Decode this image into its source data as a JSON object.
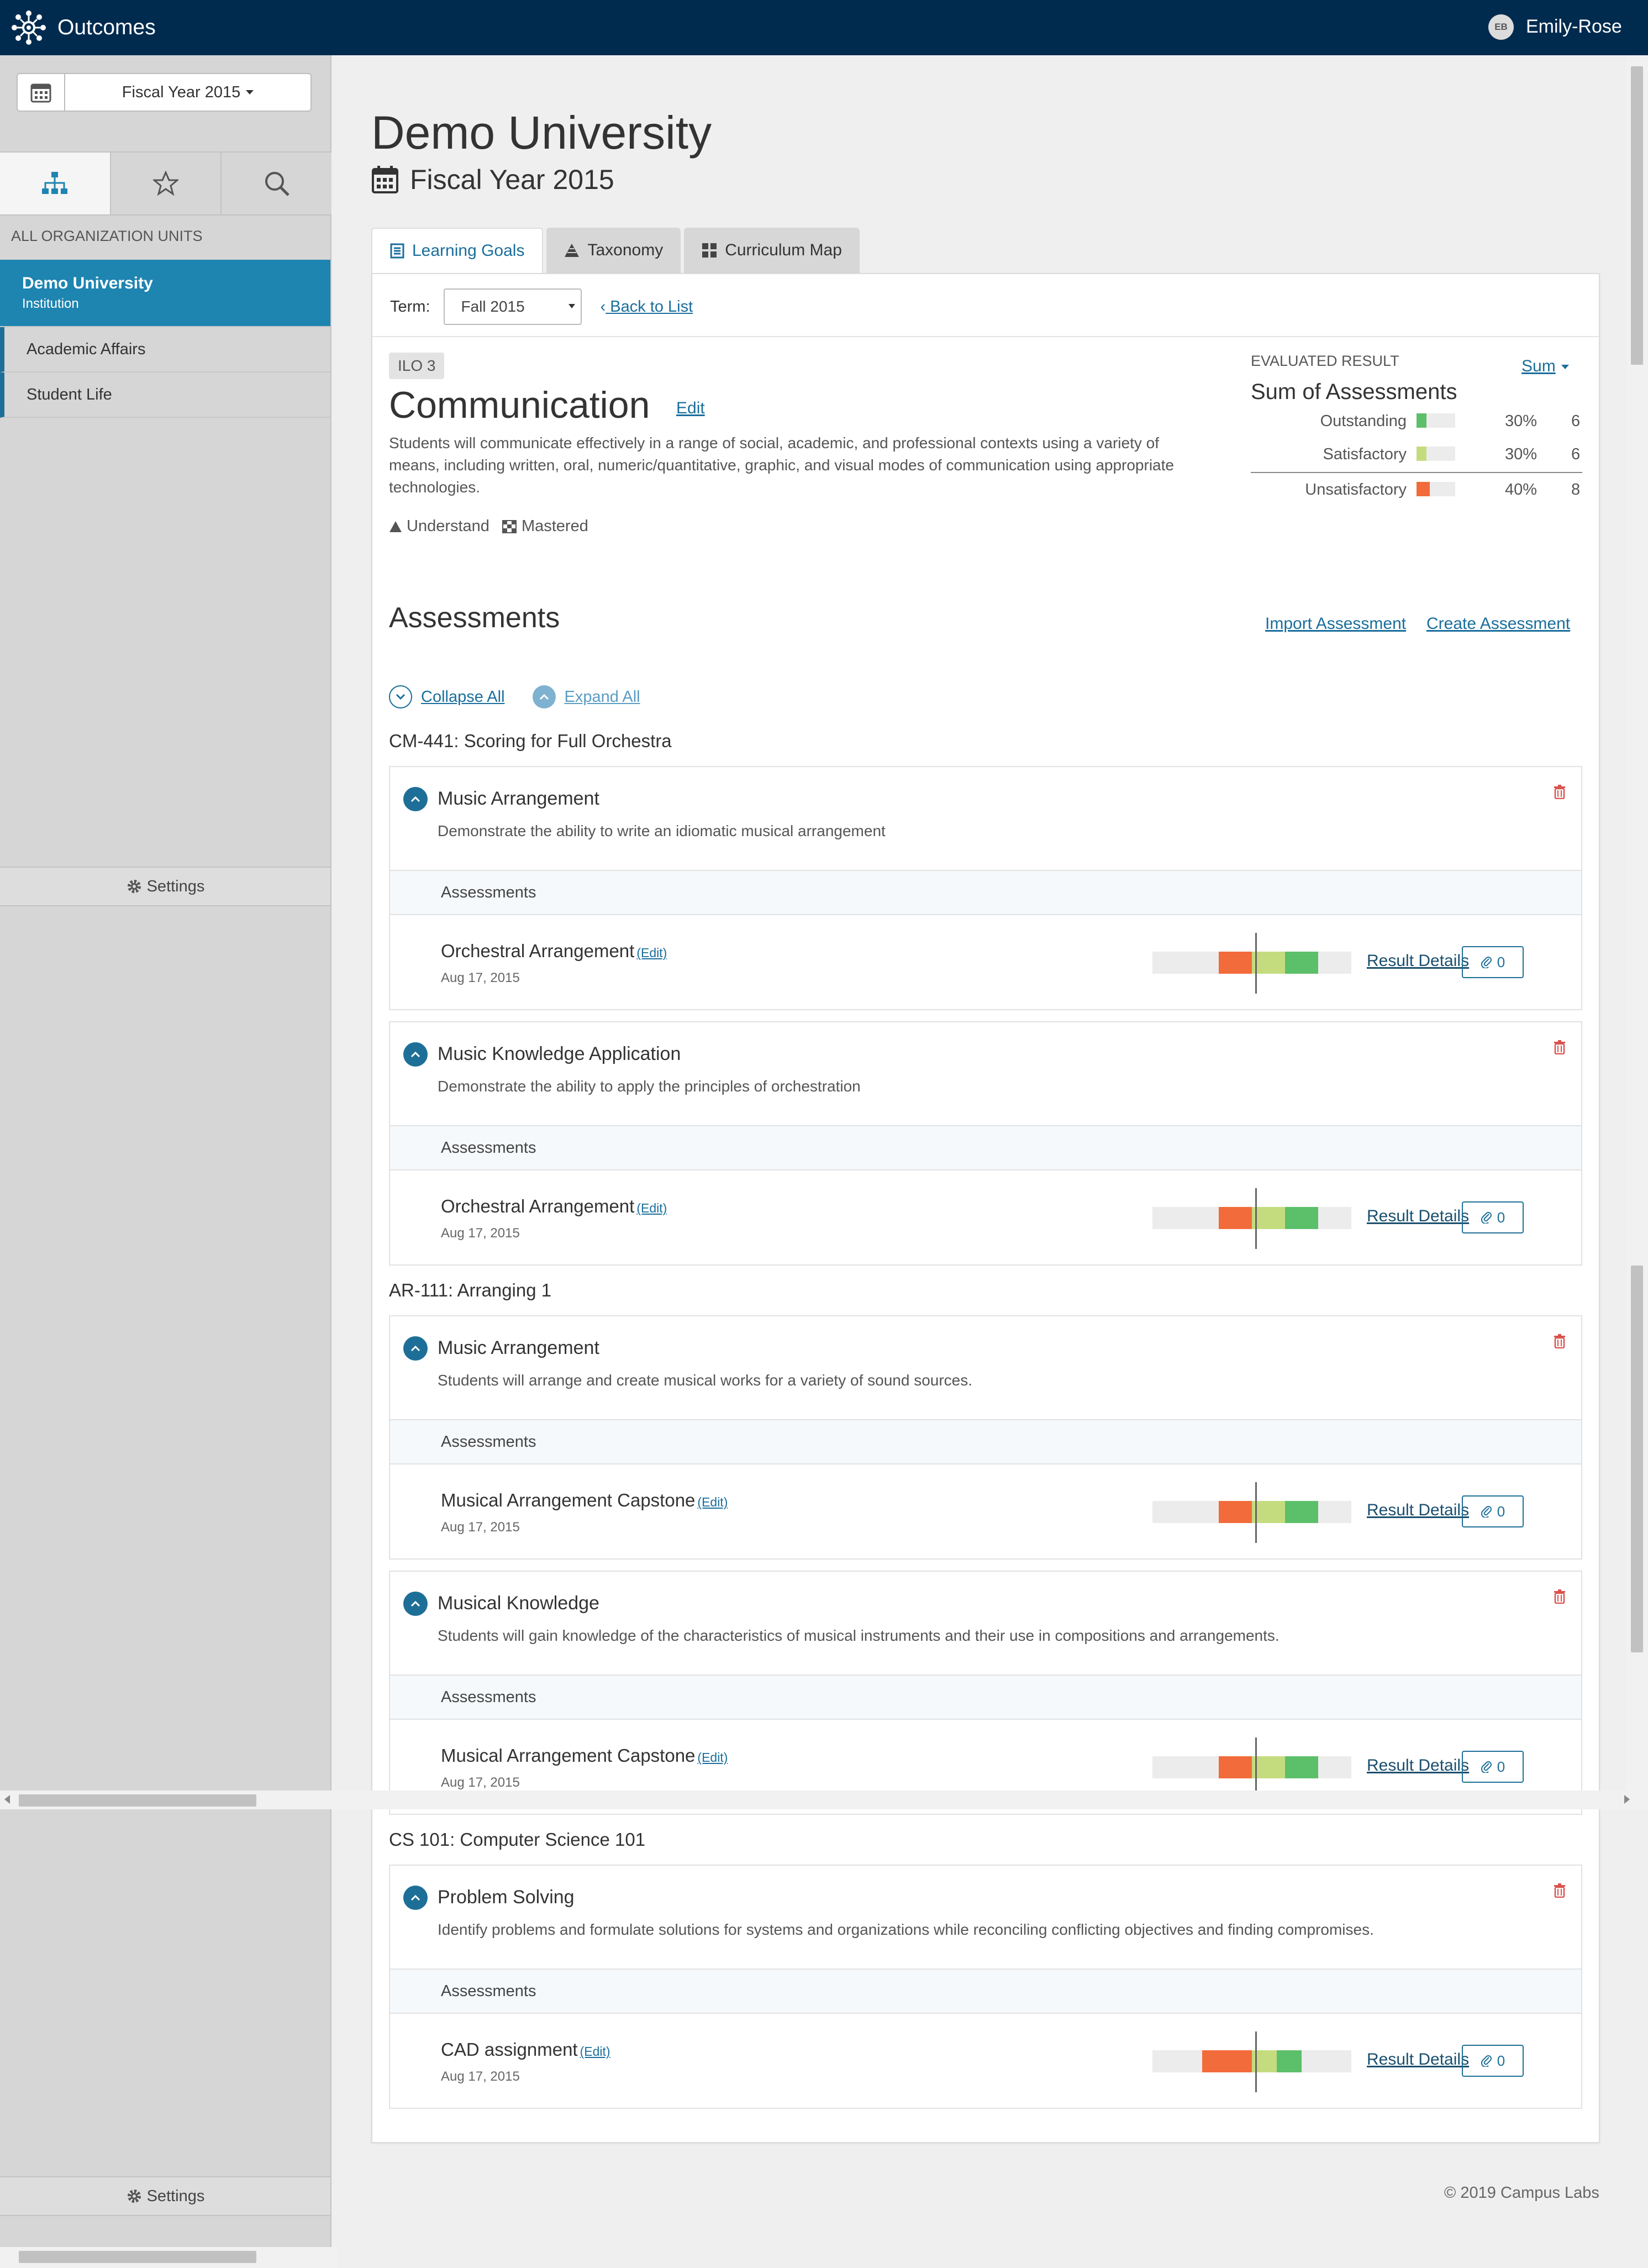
{
  "topbar": {
    "app_title": "Outcomes",
    "user_initials": "EB",
    "user_name": "Emily-Rose"
  },
  "sidebar": {
    "fiscal_year": "Fiscal Year 2015",
    "org_heading": "ALL ORGANIZATION UNITS",
    "org_units": [
      {
        "name": "Demo University",
        "sub": "Institution"
      },
      {
        "name": "Academic Affairs"
      },
      {
        "name": "Student Life"
      }
    ],
    "settings_label": "Settings"
  },
  "main": {
    "title": "Demo University",
    "fiscal_year": "Fiscal Year 2015",
    "tabs": [
      {
        "label": "Learning Goals",
        "icon": "list-icon"
      },
      {
        "label": "Taxonomy",
        "icon": "pyramid-icon"
      },
      {
        "label": "Curriculum Map",
        "icon": "grid-icon"
      }
    ],
    "term_label": "Term:",
    "term_value": "Fall 2015",
    "back_link": "Back to List"
  },
  "goal": {
    "badge": "ILO 3",
    "title": "Communication",
    "edit_label": "Edit",
    "description": "Students will communicate effectively in a range of social, academic, and professional contexts using a variety of means, including written, oral, numeric/quantitative, graphic, and visual modes of communication using appropriate technologies.",
    "tag_taxonomy": "Understand",
    "tag_mastery": "Mastered"
  },
  "evaluated": {
    "label": "EVALUATED RESULT",
    "sum_link": "Sum",
    "title": "Sum of Assessments",
    "rows": [
      {
        "label": "Outstanding",
        "pct": "30%",
        "count": "6",
        "fraction": 0.3,
        "color": "#5cbf6a"
      },
      {
        "label": "Satisfactory",
        "pct": "30%",
        "count": "6",
        "fraction": 0.3,
        "color": "#c5dc7e"
      },
      {
        "label": "Unsatisfactory",
        "pct": "40%",
        "count": "8",
        "fraction": 0.4,
        "color": "#f26b3a"
      }
    ]
  },
  "assessments": {
    "heading": "Assessments",
    "import_link": "Import Assessment",
    "create_link": "Create Assessment",
    "collapse_all": "Collapse All",
    "expand_all": "Expand All",
    "sub_header": "Assessments",
    "edit_label": "(Edit)",
    "result_details": "Result Details",
    "attach_count": "0",
    "courses": [
      {
        "name": "CM-441: Scoring for Full Orchestra"
      },
      {
        "name": "AR-111: Arranging 1"
      },
      {
        "name": "CS 101: Computer Science 101"
      }
    ],
    "cards": [
      {
        "title": "Music Arrangement",
        "desc": "Demonstrate the ability to write an idiomatic musical arrangement",
        "assessment": "Orchestral Arrangement",
        "date": "Aug 17, 2015"
      },
      {
        "title": "Music Knowledge Application",
        "desc": "Demonstrate the ability to apply the principles of orchestration",
        "assessment": "Orchestral Arrangement",
        "date": "Aug 17, 2015"
      },
      {
        "title": "Music Arrangement",
        "desc": "Students will arrange and create musical works for a variety of sound sources.",
        "assessment": "Musical Arrangement Capstone",
        "date": "Aug 17, 2015"
      },
      {
        "title": "Musical Knowledge",
        "desc": "Students will gain knowledge of the characteristics of musical instruments and their use in compositions and arrangements.",
        "assessment": "Musical Arrangement Capstone",
        "date": "Aug 17, 2015"
      },
      {
        "title": "Problem Solving",
        "desc": "Identify problems and formulate solutions for systems and organizations while reconciling conflicting objectives and finding compromises.",
        "assessment": "CAD assignment",
        "date": "Aug 17, 2015"
      }
    ]
  },
  "colors": {
    "unsatisfactory": "#f26b3a",
    "satisfactory": "#c5dc7e",
    "outstanding": "#5cbf6a",
    "navy": "#002b4f",
    "accent": "#1e6f98"
  },
  "footer": {
    "copyright": "© 2019 Campus Labs"
  }
}
